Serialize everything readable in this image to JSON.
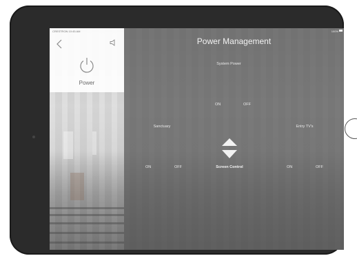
{
  "status_bar": {
    "left_text": "CRESTRON 10:45 AM",
    "battery_text": "100%"
  },
  "sidebar": {
    "items": [
      {
        "label": "Power",
        "icon": "power-icon"
      }
    ]
  },
  "main": {
    "title": "Power Management",
    "system_power": {
      "label": "System Power",
      "on_label": "ON",
      "off_label": "OFF"
    },
    "sanctuary": {
      "label": "Sanctuary",
      "on_label": "ON",
      "off_label": "OFF"
    },
    "entry_tvs": {
      "label": "Entry TV's",
      "on_label": "ON",
      "off_label": "OFF"
    },
    "screen_control": {
      "label": "Screen Control"
    }
  },
  "colors": {
    "panel_overlay": "#5f5f5f",
    "active_icon": "#f0f0f0",
    "inactive_icon": "#9a9a9a",
    "sidebar_bg": "#ffffff"
  }
}
